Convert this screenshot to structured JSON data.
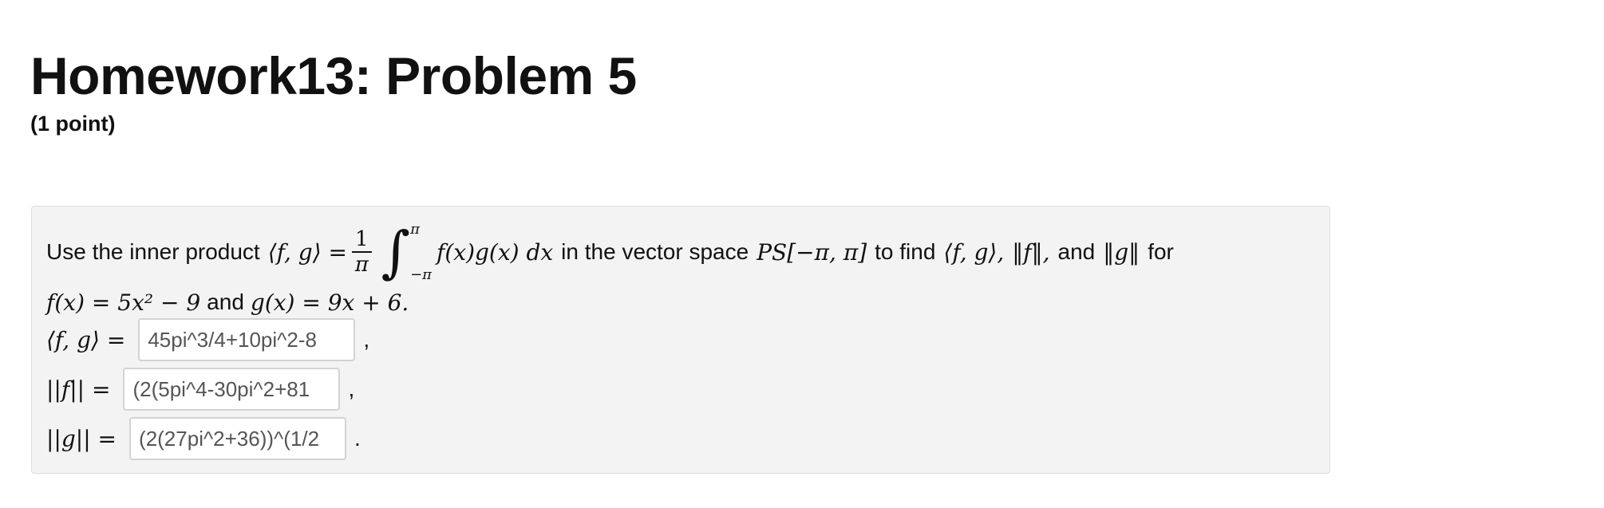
{
  "page": {
    "title": "Homework13: Problem 5",
    "points": "(1 point)"
  },
  "problem": {
    "intro": "Use the inner product",
    "inner_product_lhs": "⟨f, g⟩ =",
    "frac_num": "1",
    "frac_den": "π",
    "int_upper": "π",
    "int_lower": "−π",
    "integrand": "f(x)g(x) dx",
    "in_space": "in the vector space",
    "space": "PS[−π, π]",
    "to_find": "to find",
    "find_ip": "⟨f, g⟩,",
    "find_normf": "‖f‖,",
    "and1": "and",
    "find_normg": "‖g‖",
    "for": "for",
    "f_def": "f(x) = 5x² − 9",
    "and2": "and",
    "g_def": "g(x) = 9x + 6."
  },
  "answers": [
    {
      "label": "⟨f, g⟩ =",
      "value": "45pi^3/4+10pi^2-8",
      "punct": ","
    },
    {
      "label": "||f|| =",
      "value": "(2(5pi^4-30pi^2+81",
      "punct": ","
    },
    {
      "label": "||g|| =",
      "value": "(2(27pi^2+36))^(1/2",
      "punct": "."
    }
  ]
}
